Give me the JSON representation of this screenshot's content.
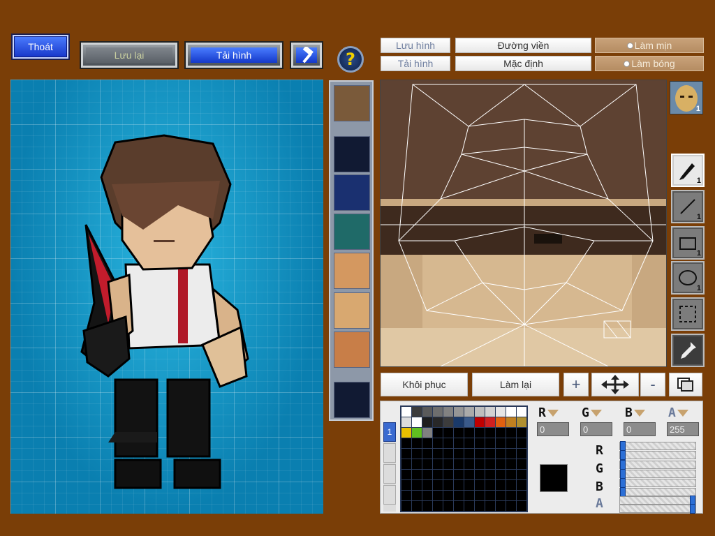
{
  "toolbar": {
    "exit": "Thoát",
    "save": "Lưu lại",
    "load": "Tải hình",
    "help": "?"
  },
  "editor_buttons": {
    "save_image": "Lưu hình",
    "load_image": "Tải hình",
    "outline": "Đường viền",
    "default": "Mặc định",
    "smooth": "Làm mịn",
    "shade": "Làm bóng",
    "restore": "Khôi phục",
    "redo": "Làm lại",
    "zoom_in": "+",
    "zoom_out": "-"
  },
  "tools": {
    "pen_size": "1",
    "line_size": "1",
    "rect_size": "1",
    "ellipse_size": "1",
    "face_badge": "1"
  },
  "color": {
    "r_label": "R",
    "g_label": "G",
    "b_label": "B",
    "a_label": "A",
    "r": "0",
    "g": "0",
    "b": "0",
    "a": "255",
    "r_slider": 0,
    "g_slider": 0,
    "b_slider": 0,
    "a_slider": 1,
    "current": "#000000",
    "palette_tab": "1",
    "palette": [
      "#ffffff",
      "#3c3c3c",
      "#5a5a5a",
      "#6e6e6e",
      "#828282",
      "#969696",
      "#aaaaaa",
      "#bebebe",
      "#d2d2d2",
      "#e6e6e6",
      "#ffffff",
      "#ffffff",
      "#dcdcdc",
      "#ffffff",
      "#1e1e1e",
      "#282828",
      "#3c3c3c",
      "#1a3a6a",
      "#3a5a8a",
      "#c00000",
      "#d02020",
      "#e06010",
      "#c08020",
      "#b09030",
      "#e8c000",
      "#60c020",
      "#808080"
    ]
  },
  "parts": [
    "face",
    "empty",
    "helmet",
    "mask",
    "face-a",
    "face-b",
    "face-c",
    "empty"
  ]
}
